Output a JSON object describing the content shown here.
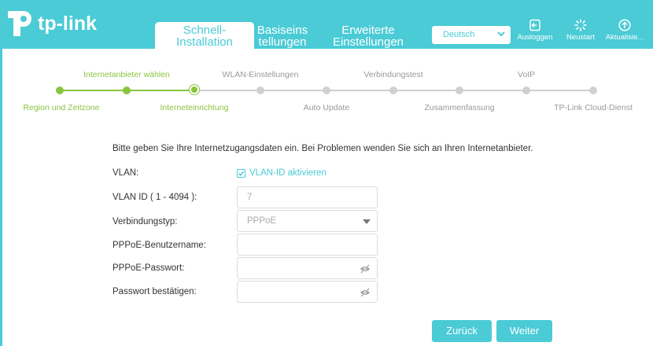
{
  "brand": {
    "logo_text": "tp-link"
  },
  "header": {
    "tabs": [
      {
        "line1": "Schnell-",
        "line2": "Installation",
        "active": true
      },
      {
        "line1": "Basiseins",
        "line2": "tellungen",
        "active": false
      },
      {
        "line1": "Erweiterte",
        "line2": "Einstellungen",
        "active": false
      }
    ],
    "language": {
      "selected": "Deutsch"
    },
    "buttons": [
      {
        "label": "Ausloggen",
        "icon": "logout-icon"
      },
      {
        "label": "Neustart",
        "icon": "reboot-icon"
      },
      {
        "label": "Aktualisie...",
        "icon": "upgrade-icon"
      }
    ]
  },
  "wizard": {
    "steps_top": [
      "Internetanbieter wählen",
      "WLAN-Einstellungen",
      "Verbindungstest",
      "VoIP"
    ],
    "steps_bottom": [
      "Region und Zeitzone",
      "Interneteinrichtung",
      "Auto Update",
      "Zusammenfassung",
      "TP-Link Cloud-Dienst"
    ],
    "current_step": 3,
    "total_steps": 9
  },
  "form": {
    "intro": "Bitte geben Sie Ihre Internetzugangsdaten ein. Bei Problemen wenden Sie sich an Ihren Internetanbieter.",
    "vlan_label": "VLAN:",
    "vlan_checkbox_label": "VLAN-ID aktivieren",
    "vlan_checked": true,
    "vlan_id_label": "VLAN ID ( 1 - 4094 ):",
    "vlan_id_value": "7",
    "conn_type_label": "Verbindungstyp:",
    "conn_type_value": "PPPoE",
    "username_label": "PPPoE-Benutzername:",
    "username_value": "",
    "password_label": "PPPoE-Passwort:",
    "password_value": "",
    "confirm_label": "Passwort bestätigen:",
    "confirm_value": ""
  },
  "actions": {
    "back": "Zurück",
    "next": "Weiter"
  },
  "colors": {
    "accent": "#4acbd6",
    "progress_done": "#8ac43f",
    "progress_todo": "#d0d0d0"
  }
}
